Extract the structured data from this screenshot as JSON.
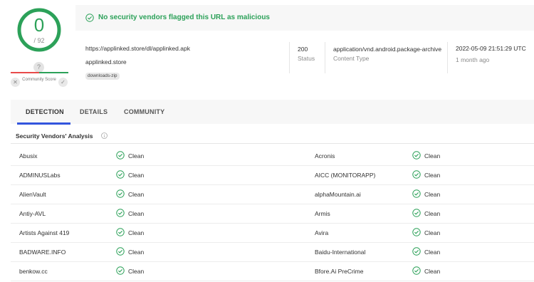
{
  "score": {
    "detections": "0",
    "total": "/ 92"
  },
  "community": {
    "unknown_glyph": "?",
    "label": "Community Score"
  },
  "banner": {
    "text": "No security vendors flagged this URL as malicious"
  },
  "info": {
    "url": "https://applinked.store/dl/applinked.apk",
    "domain": "applinked.store",
    "tag": "downloads-zip",
    "status_value": "200",
    "status_label": "Status",
    "content_type_value": "application/vnd.android.package-archive",
    "content_type_label": "Content Type",
    "date_value": "2022-05-09 21:51:29 UTC",
    "date_relative": "1 month ago"
  },
  "tabs": [
    "DETECTION",
    "DETAILS",
    "COMMUNITY"
  ],
  "section": {
    "title": "Security Vendors' Analysis"
  },
  "vendors": [
    {
      "left": "Abusix",
      "left_result": "Clean",
      "right": "Acronis",
      "right_result": "Clean"
    },
    {
      "left": "ADMINUSLabs",
      "left_result": "Clean",
      "right": "AICC (MONITORAPP)",
      "right_result": "Clean"
    },
    {
      "left": "AlienVault",
      "left_result": "Clean",
      "right": "alphaMountain.ai",
      "right_result": "Clean"
    },
    {
      "left": "Antiy-AVL",
      "left_result": "Clean",
      "right": "Armis",
      "right_result": "Clean"
    },
    {
      "left": "Artists Against 419",
      "left_result": "Clean",
      "right": "Avira",
      "right_result": "Clean"
    },
    {
      "left": "BADWARE.INFO",
      "left_result": "Clean",
      "right": "Baidu-International",
      "right_result": "Clean"
    },
    {
      "left": "benkow.cc",
      "left_result": "Clean",
      "right": "Bfore.Ai PreCrime",
      "right_result": "Clean"
    }
  ],
  "colors": {
    "clean": "#2ca159",
    "accent": "#3355dd",
    "malicious": "#e84a4a"
  }
}
